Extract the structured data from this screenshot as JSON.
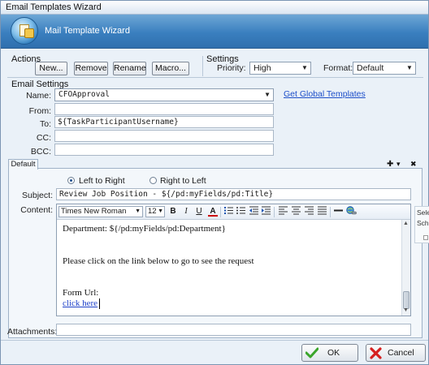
{
  "window": {
    "title": "Email Templates Wizard"
  },
  "banner": {
    "title": "Mail Template Wizard"
  },
  "actions": {
    "label": "Actions",
    "new_label": "New...",
    "remove_label": "Remove",
    "rename_label": "Rename",
    "macro_label": "Macro..."
  },
  "settings": {
    "label": "Settings",
    "priority_label": "Priority:",
    "priority_value": "High",
    "format_label": "Format:",
    "format_value": "Default"
  },
  "email_settings": {
    "label": "Email Settings",
    "name_label": "Name:",
    "name_value": "CFOApproval",
    "global_link": "Get Global Templates",
    "from_label": "From:",
    "from_value": "",
    "to_label": "To:",
    "to_value": "${TaskParticipantUsername}",
    "cc_label": "CC:",
    "cc_value": "",
    "bcc_label": "BCC:",
    "bcc_value": ""
  },
  "tab": {
    "label": "Default",
    "plus": "✚",
    "dropdown": "▾",
    "close": "✖"
  },
  "direction": {
    "ltr_label": "Left to Right",
    "rtl_label": "Right to Left",
    "selected": "ltr"
  },
  "subject": {
    "label": "Subject:",
    "value": "Review Job Position - ${/pd:myFields/pd:Title}"
  },
  "content": {
    "label": "Content:",
    "font_name": "Times New Roman",
    "font_size": "12",
    "line1": "Department: ${/pd:myFields/pd:Department}",
    "line2": "Please click on the link below to go to see the request",
    "line3": "Form Url:",
    "link_text": "click here"
  },
  "toolbar": {
    "bold": "B",
    "italic": "I",
    "underline": "U",
    "font_color": "A"
  },
  "side_panel": {
    "select_label": "Selec",
    "schema_label": "Sch"
  },
  "attachments": {
    "label": "Attachments:",
    "value": ""
  },
  "footer": {
    "ok_label": "OK",
    "cancel_label": "Cancel"
  }
}
